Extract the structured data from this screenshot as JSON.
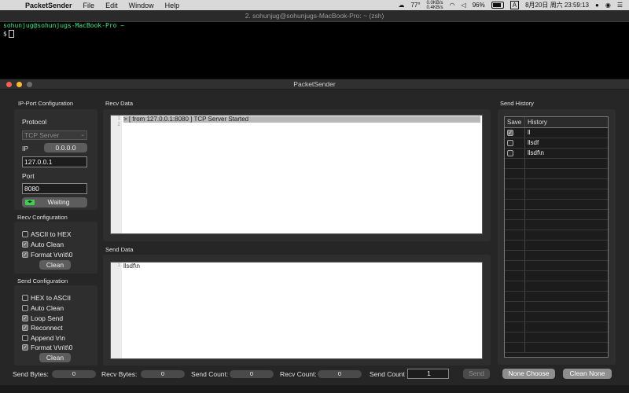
{
  "menubar": {
    "app": "PacketSender",
    "items": [
      "File",
      "Edit",
      "Window",
      "Help"
    ],
    "temperature": "77°",
    "net_up": "0.0KB/s",
    "net_down": "0.4KB/s",
    "battery": "96%",
    "input_method": "A",
    "datetime": "8月20日 周六  23:59:13"
  },
  "terminal": {
    "title": "2. sohunjug@sohunjugs-MacBook-Pro: ~ (zsh)",
    "prompt_line": "sohunjug@sohunjugs-MacBook-Pro ~",
    "prompt_symbol": "$"
  },
  "window": {
    "title": "PacketSender",
    "ip_port": {
      "section": "IP-Port Configuration",
      "protocol_label": "Protocol",
      "protocol_value": "TCP Server",
      "ip_label": "IP",
      "ip_button": "0.0.0.0",
      "ip_value": "127.0.0.1",
      "port_label": "Port",
      "port_value": "8080",
      "status_button": "Waiting"
    },
    "recv_config": {
      "section": "Recv Configuration",
      "options": [
        {
          "label": "ASCII to HEX",
          "checked": false
        },
        {
          "label": "Auto Clean",
          "checked": true
        },
        {
          "label": "Format \\r\\n\\t\\0",
          "checked": true
        }
      ],
      "clean_button": "Clean"
    },
    "send_config": {
      "section": "Send Configuration",
      "options": [
        {
          "label": "HEX to ASCII",
          "checked": false
        },
        {
          "label": "Auto Clean",
          "checked": false
        },
        {
          "label": "Loop Send",
          "checked": true
        },
        {
          "label": "Reconnect",
          "checked": true
        },
        {
          "label": "Append \\r\\n",
          "checked": false
        },
        {
          "label": "Format \\r\\n\\t\\0",
          "checked": true
        }
      ],
      "clean_button": "Clean"
    },
    "recv_data": {
      "section": "Recv Data",
      "line_numbers": [
        "1",
        "2"
      ],
      "lines": [
        "> [ from 127.0.0.1:8080 ] TCP Server Started",
        ""
      ]
    },
    "send_data": {
      "section": "Send Data",
      "line_numbers": [
        "1"
      ],
      "lines": [
        "llsdf\\n"
      ]
    },
    "history": {
      "section": "Send History",
      "headers": [
        "Save",
        "History"
      ],
      "rows": [
        {
          "saved": true,
          "text": "ll"
        },
        {
          "saved": false,
          "text": "llsdf"
        },
        {
          "saved": false,
          "text": "llsdf\\n"
        }
      ]
    },
    "status": {
      "send_bytes_label": "Send Bytes:",
      "send_bytes": "0",
      "recv_bytes_label": "Recv Bytes:",
      "recv_bytes": "0",
      "send_count_label": "Send Count:",
      "send_count_value": "0",
      "recv_count_label": "Recv Count:",
      "recv_count": "0",
      "loop_count_label": "Send Count",
      "loop_count": "1",
      "send_button": "Send",
      "none_choose_button": "None Choose",
      "clean_none_button": "Clean None"
    }
  }
}
